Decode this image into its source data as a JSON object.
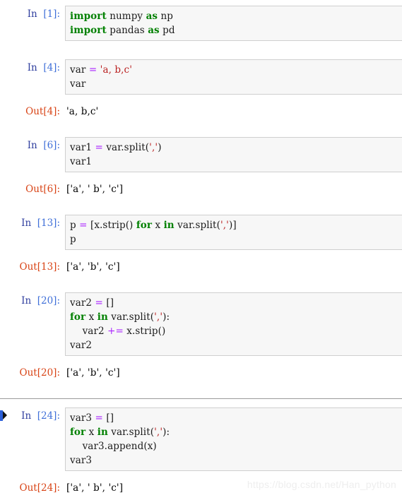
{
  "notebook": {
    "watermark": "https://blog.csdn.net/Han_python",
    "colors": {
      "keyword": "#008000",
      "operator": "#AA22FF",
      "string": "#BA2121",
      "prompt_in": "#303F9F",
      "prompt_in_number": "#3F6FD8",
      "prompt_out": "#D84315",
      "cell_background": "#f7f7f7",
      "cell_border": "#cfcfcf",
      "selected_marker": "#2B5FD9"
    },
    "cells": [
      {
        "id": "cell-1",
        "prompt_in": "In [1]:",
        "in_label": "In",
        "in_number": "[1]:",
        "selected": false,
        "lines": [
          [
            {
              "t": "import",
              "c": "kw"
            },
            {
              "t": " numpy ",
              "c": "name"
            },
            {
              "t": "as",
              "c": "kw"
            },
            {
              "t": " np",
              "c": "name"
            }
          ],
          [
            {
              "t": "import",
              "c": "kw"
            },
            {
              "t": " pandas ",
              "c": "name"
            },
            {
              "t": "as",
              "c": "kw"
            },
            {
              "t": " pd",
              "c": "name"
            }
          ]
        ],
        "output": null
      },
      {
        "id": "cell-2",
        "prompt_in": "In [4]:",
        "in_label": "In",
        "in_number": "[4]:",
        "selected": false,
        "lines": [
          [
            {
              "t": "var ",
              "c": "name"
            },
            {
              "t": "=",
              "c": "op"
            },
            {
              "t": " ",
              "c": "name"
            },
            {
              "t": "'a, b,c'",
              "c": "str"
            }
          ],
          [
            {
              "t": "var",
              "c": "name"
            }
          ]
        ],
        "output": {
          "prompt_out": "Out[4]:",
          "out_label": "Out",
          "out_number": "[4]:",
          "text": "'a, b,c'"
        }
      },
      {
        "id": "cell-3",
        "prompt_in": "In [6]:",
        "in_label": "In",
        "in_number": "[6]:",
        "selected": false,
        "lines": [
          [
            {
              "t": "var1 ",
              "c": "name"
            },
            {
              "t": "=",
              "c": "op"
            },
            {
              "t": " var.split(",
              "c": "name"
            },
            {
              "t": "','",
              "c": "str"
            },
            {
              "t": ")",
              "c": "name"
            }
          ],
          [
            {
              "t": "var1",
              "c": "name"
            }
          ]
        ],
        "output": {
          "prompt_out": "Out[6]:",
          "out_label": "Out",
          "out_number": "[6]:",
          "text": "['a', ' b', 'c']"
        }
      },
      {
        "id": "cell-4",
        "prompt_in": "In [13]:",
        "in_label": "In",
        "in_number": "[13]:",
        "selected": false,
        "lines": [
          [
            {
              "t": "p ",
              "c": "name"
            },
            {
              "t": "=",
              "c": "op"
            },
            {
              "t": " [x.strip() ",
              "c": "name"
            },
            {
              "t": "for",
              "c": "kw"
            },
            {
              "t": " x ",
              "c": "name"
            },
            {
              "t": "in",
              "c": "kw"
            },
            {
              "t": " var.split(",
              "c": "name"
            },
            {
              "t": "','",
              "c": "str"
            },
            {
              "t": ")]",
              "c": "name"
            }
          ],
          [
            {
              "t": "p",
              "c": "name"
            }
          ]
        ],
        "output": {
          "prompt_out": "Out[13]:",
          "out_label": "Out",
          "out_number": "[13]:",
          "text": "['a', 'b', 'c']"
        }
      },
      {
        "id": "cell-5",
        "prompt_in": "In [20]:",
        "in_label": "In",
        "in_number": "[20]:",
        "selected": false,
        "lines": [
          [
            {
              "t": "var2 ",
              "c": "name"
            },
            {
              "t": "=",
              "c": "op"
            },
            {
              "t": " []",
              "c": "name"
            }
          ],
          [
            {
              "t": "for",
              "c": "kw"
            },
            {
              "t": " x ",
              "c": "name"
            },
            {
              "t": "in",
              "c": "kw"
            },
            {
              "t": " var.split(",
              "c": "name"
            },
            {
              "t": "','",
              "c": "str"
            },
            {
              "t": "):",
              "c": "name"
            }
          ],
          [
            {
              "t": "    var2 ",
              "c": "name"
            },
            {
              "t": "+=",
              "c": "op"
            },
            {
              "t": " x.strip()",
              "c": "name"
            }
          ],
          [
            {
              "t": "var2",
              "c": "name"
            }
          ]
        ],
        "output": {
          "prompt_out": "Out[20]:",
          "out_label": "Out",
          "out_number": "[20]:",
          "text": "['a', 'b', 'c']"
        }
      },
      {
        "id": "cell-6",
        "prompt_in": "In [24]:",
        "in_label": "In",
        "in_number": "[24]:",
        "selected": true,
        "lines": [
          [
            {
              "t": "var3 ",
              "c": "name"
            },
            {
              "t": "=",
              "c": "op"
            },
            {
              "t": " []",
              "c": "name"
            }
          ],
          [
            {
              "t": "for",
              "c": "kw"
            },
            {
              "t": " x ",
              "c": "name"
            },
            {
              "t": "in",
              "c": "kw"
            },
            {
              "t": " var.split(",
              "c": "name"
            },
            {
              "t": "','",
              "c": "str"
            },
            {
              "t": "):",
              "c": "name"
            }
          ],
          [
            {
              "t": "    var3.append(x)",
              "c": "name"
            }
          ],
          [
            {
              "t": "var3",
              "c": "name"
            }
          ]
        ],
        "output": {
          "prompt_out": "Out[24]:",
          "out_label": "Out",
          "out_number": "[24]:",
          "text": "['a', ' b', 'c']"
        }
      }
    ]
  }
}
